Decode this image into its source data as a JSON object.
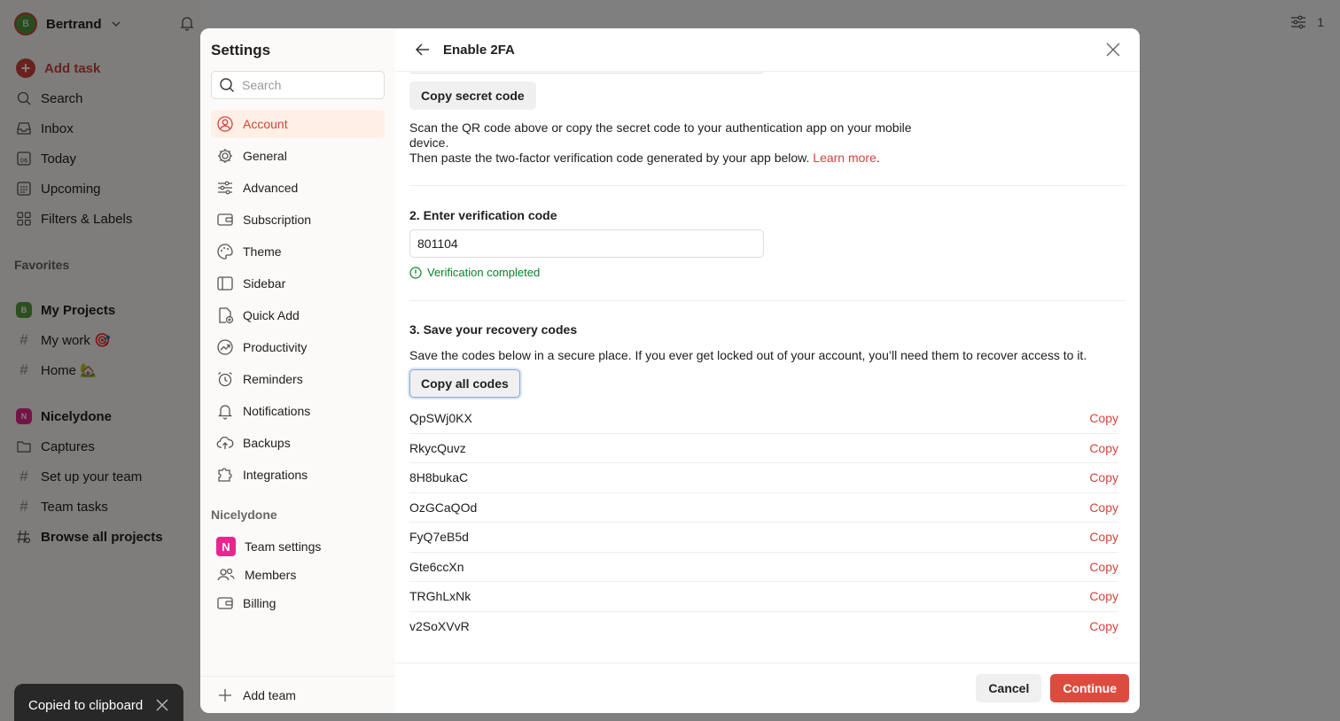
{
  "app": {
    "user_initial": "B",
    "user_name": "Bertrand",
    "nav": [
      {
        "label": "Add task"
      },
      {
        "label": "Search"
      },
      {
        "label": "Inbox"
      },
      {
        "label": "Today"
      },
      {
        "label": "Upcoming"
      },
      {
        "label": "Filters & Labels"
      }
    ],
    "favorites_title": "Favorites",
    "favorites": [
      {
        "badge": "B",
        "label": "My Projects"
      },
      {
        "label": "My work 🎯"
      },
      {
        "label": "Home 🏡"
      }
    ],
    "team": [
      {
        "badge": "N",
        "label": "Nicelydone"
      },
      {
        "label": "Captures"
      },
      {
        "label": "Set up your team"
      },
      {
        "label": "Team tasks"
      },
      {
        "label": "Browse all projects"
      }
    ],
    "filter_count": "1"
  },
  "toast": {
    "message": "Copied to clipboard"
  },
  "settings": {
    "title": "Settings",
    "search_placeholder": "Search",
    "items": [
      {
        "label": "Account"
      },
      {
        "label": "General"
      },
      {
        "label": "Advanced"
      },
      {
        "label": "Subscription"
      },
      {
        "label": "Theme"
      },
      {
        "label": "Sidebar"
      },
      {
        "label": "Quick Add"
      },
      {
        "label": "Productivity"
      },
      {
        "label": "Reminders"
      },
      {
        "label": "Notifications"
      },
      {
        "label": "Backups"
      },
      {
        "label": "Integrations"
      }
    ],
    "team_title": "Nicelydone",
    "team_badge": "N",
    "team_items": [
      {
        "label": "Team settings"
      },
      {
        "label": "Members"
      },
      {
        "label": "Billing"
      }
    ],
    "add_team": "Add team"
  },
  "twofa": {
    "title": "Enable 2FA",
    "copy_secret": "Copy secret code",
    "desc_line1": "Scan the QR code above or copy the secret code to your authentication app on your mobile device.",
    "desc_line2": "Then paste the two-factor verification code generated by your app below.",
    "learn_more": "Learn more",
    "desc_end": ".",
    "step2_title": "2. Enter verification code",
    "code_value": "801104",
    "verified_text": "Verification completed",
    "step3_title": "3. Save your recovery codes",
    "step3_desc": "Save the codes below in a secure place. If you ever get locked out of your account, you’ll need them to recover access to it.",
    "copy_all": "Copy all codes",
    "copy_label": "Copy",
    "codes": [
      "QpSWj0KX",
      "RkycQuvz",
      "8H8bukaC",
      "OzGCaQOd",
      "FyQ7eB5d",
      "Gte6ccXn",
      "TRGhLxNk",
      "v2SoXVvR"
    ],
    "cancel": "Cancel",
    "continue": "Continue"
  },
  "colors": {
    "accent": "#dc4c3e",
    "success": "#058527",
    "active_bg": "#ffefe5"
  }
}
